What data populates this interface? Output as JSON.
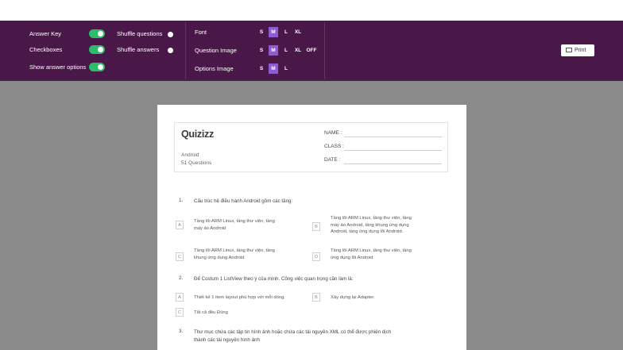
{
  "toolbar": {
    "answer_key": "Answer Key",
    "checkboxes": "Checkboxes",
    "show_answer_options": "Show answer options",
    "shuffle_questions": "Shuffle questions",
    "shuffle_answers": "Shuffle answers",
    "font_label": "Font",
    "question_image_label": "Question Image",
    "options_image_label": "Options Image",
    "size_s": "S",
    "size_m": "M",
    "size_l": "L",
    "size_xl": "XL",
    "size_off": "OFF",
    "print_label": "Print",
    "accent_color": "#4a1848",
    "toggle_color": "#2ebc6a",
    "selected_size_color": "#8e5bd0"
  },
  "sheet": {
    "logo": "Quizizz",
    "subject": "Android",
    "question_count": "51 Questions",
    "name_label": "NAME :",
    "class_label": "CLASS :",
    "date_label": "DATE :"
  },
  "questions": [
    {
      "number": "1.",
      "text": "Cấu trúc hệ điều hành Android gồm các tầng:",
      "options": [
        {
          "letter": "A",
          "lines": [
            "Tầng lõi ARM Linux, tầng thư viện, tầng",
            "máy ảo Android"
          ]
        },
        {
          "letter": "B",
          "lines": [
            "Tầng lõi ARM Linux, tầng thư viện, tầng",
            "máy ảo Android, tầng khung ứng dụng",
            "Android, tầng ứng dụng lõi Android."
          ]
        },
        {
          "letter": "C",
          "lines": [
            "Tầng lõi ARM Linux, tầng thư viện, tầng",
            "khung ứng dụng Android"
          ]
        },
        {
          "letter": "D",
          "lines": [
            "Tầng lõi ARM Linux, tầng thư viện, tầng",
            "ứng dụng lõi Android"
          ]
        }
      ]
    },
    {
      "number": "2.",
      "text": "Để Costum 1 ListView theo ý của mình. Công việc quan trọng cần làm là:",
      "options": [
        {
          "letter": "A",
          "lines": [
            "Thiết kế 1 item layout phù hợp với mỗi dòng."
          ]
        },
        {
          "letter": "B",
          "lines": [
            "Xây dựng lại Adapter."
          ]
        },
        {
          "letter": "C",
          "lines": [
            "Tất cả đều Đúng"
          ]
        }
      ]
    },
    {
      "number": "3.",
      "text": "Thư mục chứa các tập tin hình ảnh hoặc chứa các tài nguyên XML có thể được phiên dịch",
      "text2": "thành các tài nguyên hình ảnh"
    }
  ]
}
